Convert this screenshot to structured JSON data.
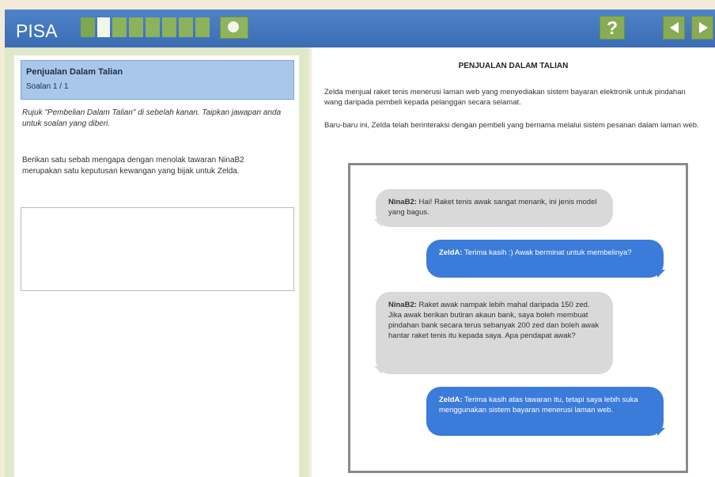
{
  "app": {
    "logo": "PISA"
  },
  "progress": {
    "segments_total": 8,
    "current_index": 1
  },
  "left": {
    "unit_title": "Penjualan Dalam Talian",
    "question_number": "Soalan 1 / 1",
    "instruction": "Rujuk \"Pembelian Dalam Talian\" di sebelah kanan. Taipkan jawapan anda untuk soalan yang diberi.",
    "question": "Berikan satu sebab mengapa dengan menolak tawaran NinaB2 merupakan satu keputusan kewangan yang bijak untuk Zelda.",
    "answer_value": ""
  },
  "right": {
    "title": "PENJUALAN DALAM TALIAN",
    "para1": "Zelda menjual raket tenis menerusi laman web yang menyediakan sistem bayaran elektronik untuk pindahan wang daripada pembeli kepada pelanggan secara selamat.",
    "para2": "Baru-baru ini, Zelda telah berinteraksi dengan pembeli yang bernama melalui sistem pesanan dalam laman web.",
    "chat": [
      {
        "sender": "NinaB2:",
        "text": " Hai! Raket tenis awak sangat menarik, ini jenis model yang bagus."
      },
      {
        "sender": "ZeldA:",
        "text": " Terima kasih :) Awak berminat untuk membelinya?"
      },
      {
        "sender": "NinaB2:",
        "text": " Raket awak nampak lebih mahal daripada 150 zed. Jika awak berikan butiran akaun bank, saya boleh membuat pindahan bank secara terus sebanyak 200 zed dan boleh awak hantar raket tenis itu kepada saya. Apa pendapat awak?"
      },
      {
        "sender": "ZeldA:",
        "text": " Terima kasih atas tawaran itu, tetapi saya lebih suka menggunakan sistem bayaran menerusi laman web."
      }
    ]
  },
  "icons": {
    "help": "?",
    "prev": "triangle-left-icon",
    "next": "triangle-right-icon",
    "timer": "clock-icon"
  },
  "colors": {
    "topbar": "#4277be",
    "accent_green": "#87ac55",
    "left_panel_bg": "#dfe9c9",
    "question_header": "#a9c7ea",
    "bubble_in": "#d9d9d9",
    "bubble_out": "#3b7bd9"
  }
}
